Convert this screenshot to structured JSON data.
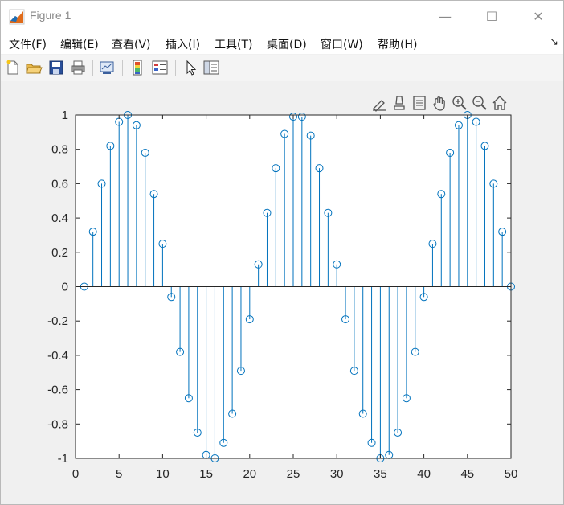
{
  "window": {
    "title": "Figure 1",
    "controls": {
      "minimize": "—",
      "maximize": "☐",
      "close": "✕"
    }
  },
  "menu": {
    "items": [
      "文件(F)",
      "编辑(E)",
      "查看(V)",
      "插入(I)",
      "工具(T)",
      "桌面(D)",
      "窗口(W)",
      "帮助(H)"
    ],
    "extra": "↘"
  },
  "toolbar": {
    "buttons": [
      "new-figure-icon",
      "open-file-icon",
      "save-icon",
      "print-icon",
      "link-plot-icon",
      "colorbar-icon",
      "legend-icon",
      "pointer-icon",
      "property-editor-icon"
    ]
  },
  "axes_toolbar": {
    "buttons": [
      "brush-icon",
      "data-cursor-icon",
      "restore-view-icon",
      "pan-icon",
      "zoom-in-icon",
      "zoom-out-icon",
      "home-icon"
    ]
  },
  "colors": {
    "stem": "#0072bd",
    "axis": "#262626",
    "background": "#f0f0f0"
  },
  "chart_data": {
    "type": "stem",
    "title": "",
    "xlabel": "",
    "ylabel": "",
    "xlim": [
      0,
      50
    ],
    "ylim": [
      -1,
      1
    ],
    "xticks": [
      0,
      5,
      10,
      15,
      20,
      25,
      30,
      35,
      40,
      45,
      50
    ],
    "yticks": [
      1,
      0.8,
      0.6,
      0.4,
      0.2,
      0,
      -0.2,
      -0.4,
      -0.6,
      -0.8,
      -1
    ],
    "ytick_labels": [
      "1",
      "0.8",
      "0.6",
      "0.4",
      "0.2",
      "0",
      "-0.2",
      "-0.4",
      "-0.6",
      "-0.8",
      "-1"
    ],
    "grid": false,
    "series": [
      {
        "marker": "circle",
        "x": [
          1,
          2,
          3,
          4,
          5,
          6,
          7,
          8,
          9,
          10,
          11,
          12,
          13,
          14,
          15,
          16,
          17,
          18,
          19,
          20,
          21,
          22,
          23,
          24,
          25,
          26,
          27,
          28,
          29,
          30,
          31,
          32,
          33,
          34,
          35,
          36,
          37,
          38,
          39,
          40,
          41,
          42,
          43,
          44,
          45,
          46,
          47,
          48,
          49,
          50
        ],
        "y": [
          0,
          0.32,
          0.6,
          0.82,
          0.96,
          1,
          0.94,
          0.78,
          0.54,
          0.25,
          -0.06,
          -0.38,
          -0.65,
          -0.85,
          -0.98,
          -1,
          -0.91,
          -0.74,
          -0.49,
          -0.19,
          0.13,
          0.43,
          0.69,
          0.89,
          0.99,
          0.99,
          0.88,
          0.69,
          0.43,
          0.13,
          -0.19,
          -0.49,
          -0.74,
          -0.91,
          -1,
          -0.98,
          -0.85,
          -0.65,
          -0.38,
          -0.06,
          0.25,
          0.54,
          0.78,
          0.94,
          1,
          0.96,
          0.82,
          0.6,
          0.32,
          0
        ]
      }
    ]
  }
}
